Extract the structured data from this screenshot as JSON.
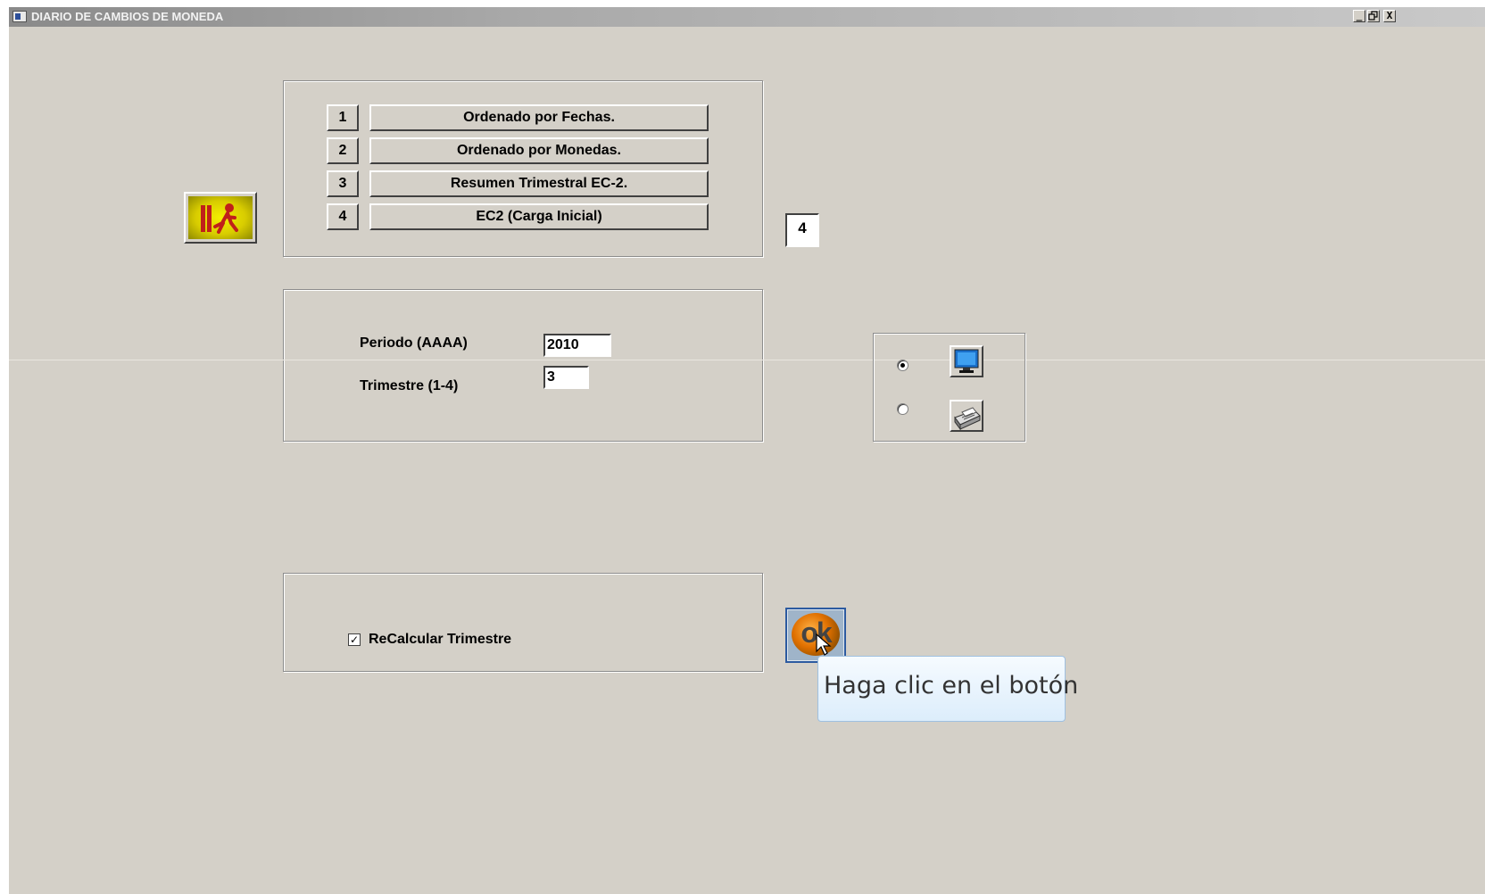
{
  "window": {
    "title": "DIARIO DE CAMBIOS DE MONEDA",
    "controls": [
      "_",
      "▫",
      "X"
    ]
  },
  "menu": {
    "items": [
      {
        "number": "1",
        "label": "Ordenado por Fechas."
      },
      {
        "number": "2",
        "label": "Ordenado por Monedas."
      },
      {
        "number": "3",
        "label": "Resumen Trimestral EC-2."
      },
      {
        "number": "4",
        "label": "EC2 (Carga Inicial)"
      }
    ],
    "selected_option": "4"
  },
  "params": {
    "period_label": "Periodo (AAAA)",
    "period_value": "2010",
    "quarter_label": "Trimestre (1-4)",
    "quarter_value": "3"
  },
  "output": {
    "options": [
      {
        "name": "screen",
        "icon": "monitor-icon",
        "checked": true
      },
      {
        "name": "printer",
        "icon": "printer-icon",
        "checked": false
      }
    ]
  },
  "recalc": {
    "label": "ReCalcular Trimestre",
    "checked": true
  },
  "ok_button": {
    "label": "ok"
  },
  "tooltip": {
    "text": "Haga clic en el botón"
  },
  "colors": {
    "background": "#d4d0c8",
    "exit_button": "#f4f000",
    "ok_border": "#2c5aa0"
  }
}
